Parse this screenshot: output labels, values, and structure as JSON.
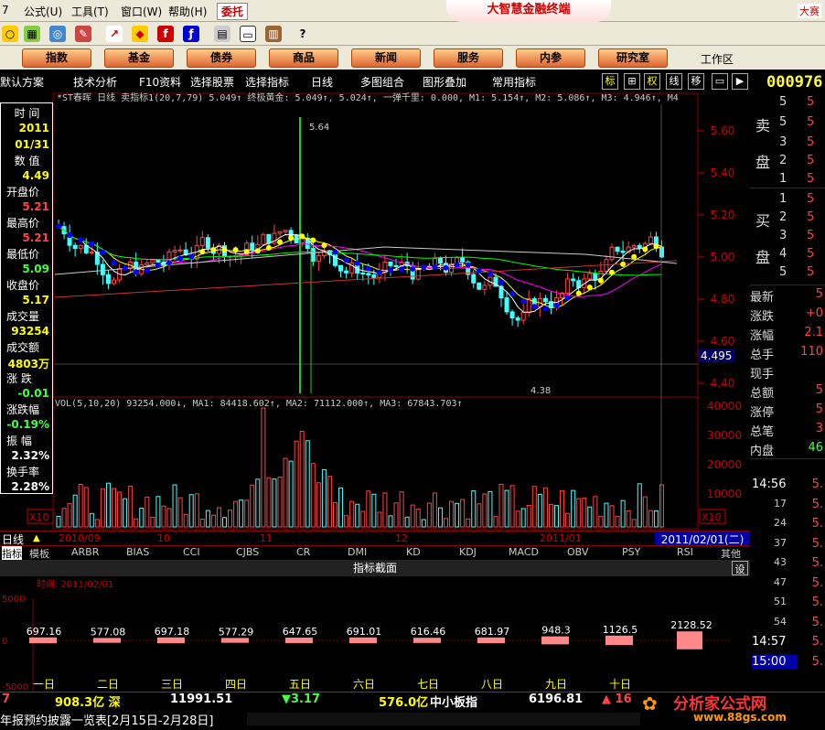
{
  "menubar": {
    "items": [
      "公式(U)",
      "工具(T)",
      "窗口(W)",
      "帮助(H)"
    ],
    "wt": "委托",
    "logo": "大智慧金融终端",
    "dasai": "大赛"
  },
  "nav": {
    "buttons": [
      "指数",
      "基金",
      "债券",
      "商品",
      "新闻",
      "服务",
      "内参",
      "研究室"
    ],
    "workarea": "工作区"
  },
  "optbar": {
    "items": [
      "默认方案",
      "技术分析",
      "F10资料",
      "选择股票",
      "选择指标",
      "日线",
      "多图组合",
      "图形叠加",
      "常用指标"
    ],
    "side": [
      "标",
      "⊞",
      "权",
      "线",
      "移"
    ]
  },
  "code": "000976",
  "chart": {
    "title_line": "*ST春晖  日线  卖指标1(20,7,79) 5.049↑  终极黄金: 5.049↑, 5.024↑, 一弹千里: 0.000, M1: 5.154↑, M2: 5.086↑, M3: 4.946↑, M4",
    "vol_line": "VOL(5,10,20) 93254.000↓, MA1: 84418.602↑, MA2: 71112.000↑, MA3: 67843.703↑",
    "high_label": "5.64",
    "low_label": "4.38",
    "cursor_price": "4.495",
    "price_ticks": [
      "5.60",
      "5.40",
      "5.20",
      "5.00",
      "4.80",
      "4.60",
      "4.40"
    ],
    "vol_ticks": [
      "40000",
      "30000",
      "20000",
      "10000"
    ],
    "x10": "X10",
    "x10b": "X10",
    "date_axis": [
      "2010/09",
      "10",
      "11",
      "12",
      "2011/01"
    ],
    "date_box": "2011/02/01(二)",
    "period": "日线"
  },
  "leftpanel": {
    "labels": [
      "时 间",
      "数 值",
      "开盘价",
      "最高价",
      "最低价",
      "收盘价",
      "成交量",
      "成交额",
      "涨 跌",
      "涨跌幅",
      "振 幅",
      "换手率"
    ],
    "values": [
      "2011",
      "01/31",
      "4.49",
      "5.21",
      "5.21",
      "5.09",
      "5.17",
      "93254",
      "4803万",
      "-0.01",
      "-0.19%",
      "2.32%",
      "2.28%"
    ]
  },
  "rightpanel": {
    "sell_label": "卖",
    "sell_label2": "盘",
    "buy_label": "买",
    "buy_label2": "盘",
    "sell": [
      "5",
      "5",
      "3",
      "2",
      "1"
    ],
    "sell_right": [
      "5",
      "5",
      "5",
      "5",
      "5"
    ],
    "buy": [
      "1",
      "2",
      "3",
      "4",
      "5"
    ],
    "buy_right": [
      "5",
      "5",
      "5",
      "5",
      "5"
    ],
    "stats": [
      "最新",
      "涨跌",
      "涨幅",
      "总手",
      "现手",
      "总额",
      "涨停",
      "总笔",
      "内盘"
    ],
    "stat_vals": [
      "5",
      "+0",
      "2.1",
      "110",
      "",
      "5",
      "5",
      "3",
      "46"
    ],
    "times": [
      "14:56",
      "17",
      "24",
      "37",
      "43",
      "47",
      "51",
      "54",
      "14:57",
      "15:00"
    ],
    "time_vals": [
      "5.",
      "5.",
      "5.",
      "5.",
      "5.",
      "5.",
      "5.",
      "5.",
      "5.",
      "5."
    ]
  },
  "bottomtabs": {
    "items": [
      "指标",
      "模板",
      "ARBR",
      "BIAS",
      "CCI",
      "CJBS",
      "CR",
      "DMI",
      "KD",
      "KDJ",
      "MACD",
      "OBV",
      "PSY",
      "RSI",
      "其他"
    ]
  },
  "indicator": {
    "title": "指标截面",
    "set": "设",
    "time": "时间: 2011/02/01",
    "yticks": [
      "5000",
      "0",
      "-5000"
    ],
    "labels": [
      "一日",
      "二日",
      "三日",
      "四日",
      "五日",
      "六日",
      "七日",
      "八日",
      "九日",
      "十日"
    ],
    "chart_data": {
      "type": "bar",
      "categories": [
        "一日",
        "二日",
        "三日",
        "四日",
        "五日",
        "六日",
        "七日",
        "八日",
        "九日",
        "十日",
        ""
      ],
      "values": [
        697.16,
        577.08,
        697.18,
        577.29,
        647.65,
        691.01,
        616.46,
        681.97,
        948.3,
        1126.5,
        2128.52
      ]
    }
  },
  "status": {
    "a": "908.3亿 深",
    "b": "11991.51",
    "c": "▼3.17",
    "d": "576.0亿",
    "e": "中小板指",
    "f": "6196.81",
    "g": "▲ 16",
    "ticker": "年报预约披露一览表[2月15日-2月28日]",
    "brand": "分析家公式网",
    "url": "www.88gs.com"
  }
}
